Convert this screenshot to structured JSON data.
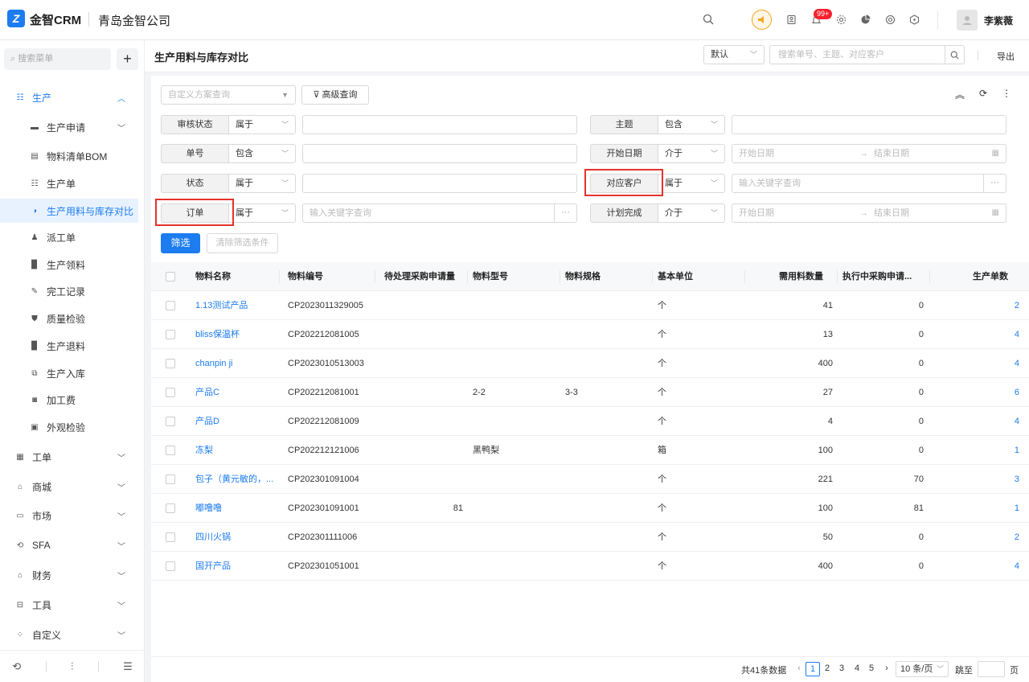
{
  "topbar": {
    "brand": "金智CRM",
    "company": "青岛金智公司",
    "badge": "99+",
    "username": "李紫薇"
  },
  "sidebar": {
    "search_placeholder": "搜索菜单",
    "items": [
      {
        "label": "生产",
        "icon": "production-icon"
      },
      {
        "label": "生产申请",
        "icon": "folder-icon"
      },
      {
        "label": "物料清单BOM",
        "icon": "bom-icon"
      },
      {
        "label": "生产单",
        "icon": "production-order-icon"
      },
      {
        "label": "生产用料与库存对比",
        "icon": "pie-icon"
      },
      {
        "label": "派工单",
        "icon": "worker-icon"
      },
      {
        "label": "生产领料",
        "icon": "doc-icon"
      },
      {
        "label": "完工记录",
        "icon": "edit-icon"
      },
      {
        "label": "质量检验",
        "icon": "shield-icon"
      },
      {
        "label": "生产退料",
        "icon": "doc-icon"
      },
      {
        "label": "生产入库",
        "icon": "storage-icon"
      },
      {
        "label": "加工费",
        "icon": "fee-icon"
      },
      {
        "label": "外观检验",
        "icon": "inspect-icon"
      },
      {
        "label": "工单",
        "icon": "ticket-icon"
      },
      {
        "label": "商城",
        "icon": "mall-icon"
      },
      {
        "label": "市场",
        "icon": "market-icon"
      },
      {
        "label": "SFA",
        "icon": "sfa-icon"
      },
      {
        "label": "财务",
        "icon": "finance-icon"
      },
      {
        "label": "工具",
        "icon": "tools-icon"
      },
      {
        "label": "自定义",
        "icon": "grid-icon"
      }
    ]
  },
  "header": {
    "title": "生产用料与库存对比",
    "view": "默认",
    "search_placeholder": "搜索单号、主题、对应客户",
    "export": "导出"
  },
  "filters": {
    "scheme_placeholder": "自定义方案查询",
    "advanced": "高级查询",
    "rows": [
      {
        "label": "审核状态",
        "op": "属于",
        "placeholder": ""
      },
      {
        "label": "主题",
        "op": "包含",
        "placeholder": ""
      },
      {
        "label": "单号",
        "op": "包含",
        "placeholder": ""
      },
      {
        "label": "开始日期",
        "op": "介于",
        "start": "开始日期",
        "end": "结束日期"
      },
      {
        "label": "状态",
        "op": "属于",
        "placeholder": ""
      },
      {
        "label": "对应客户",
        "op": "属于",
        "placeholder": "输入关键字查询"
      },
      {
        "label": "订单",
        "op": "属于",
        "placeholder": "输入关键字查询"
      },
      {
        "label": "计划完成",
        "op": "介于",
        "start": "开始日期",
        "end": "结束日期"
      }
    ],
    "apply": "筛选",
    "clear": "清除筛选条件"
  },
  "table": {
    "columns": [
      "物料名称",
      "物料编号",
      "待处理采购申请量",
      "物料型号",
      "物料规格",
      "基本单位",
      "需用料数量",
      "执行中采购申请...",
      "生产单数"
    ],
    "rows": [
      {
        "name": "1.13测试产品",
        "code": "CP2023011329005",
        "pending": "",
        "model": "",
        "spec": "",
        "unit": "个",
        "qty": "41",
        "exec": "0",
        "orders": "2"
      },
      {
        "name": "bliss保温杯",
        "code": "CP202212081005",
        "pending": "",
        "model": "",
        "spec": "",
        "unit": "个",
        "qty": "13",
        "exec": "0",
        "orders": "4"
      },
      {
        "name": "chanpin ji",
        "code": "CP2023010513003",
        "pending": "",
        "model": "",
        "spec": "",
        "unit": "个",
        "qty": "400",
        "exec": "0",
        "orders": "4"
      },
      {
        "name": "产品C",
        "code": "CP202212081001",
        "pending": "",
        "model": "2-2",
        "spec": "3-3",
        "unit": "个",
        "qty": "27",
        "exec": "0",
        "orders": "6"
      },
      {
        "name": "产品D",
        "code": "CP202212081009",
        "pending": "",
        "model": "",
        "spec": "",
        "unit": "个",
        "qty": "4",
        "exec": "0",
        "orders": "4"
      },
      {
        "name": "冻梨",
        "code": "CP202212121006",
        "pending": "",
        "model": "黑鸭梨",
        "spec": "",
        "unit": "箱",
        "qty": "100",
        "exec": "0",
        "orders": "1"
      },
      {
        "name": "包子（黄元敏的，...",
        "code": "CP202301091004",
        "pending": "",
        "model": "",
        "spec": "",
        "unit": "个",
        "qty": "221",
        "exec": "70",
        "orders": "3"
      },
      {
        "name": "嘟噜噜",
        "code": "CP202301091001",
        "pending": "81",
        "model": "",
        "spec": "",
        "unit": "个",
        "qty": "100",
        "exec": "81",
        "orders": "1"
      },
      {
        "name": "四川火锅",
        "code": "CP202301111006",
        "pending": "",
        "model": "",
        "spec": "",
        "unit": "个",
        "qty": "50",
        "exec": "0",
        "orders": "2"
      },
      {
        "name": "国开产品",
        "code": "CP202301051001",
        "pending": "",
        "model": "",
        "spec": "",
        "unit": "个",
        "qty": "400",
        "exec": "0",
        "orders": "4"
      }
    ]
  },
  "pager": {
    "total": "共41条数据",
    "pages": [
      "1",
      "2",
      "3",
      "4",
      "5"
    ],
    "current": "1",
    "size": "10 条/页",
    "jump": "跳至",
    "page_unit": "页"
  }
}
